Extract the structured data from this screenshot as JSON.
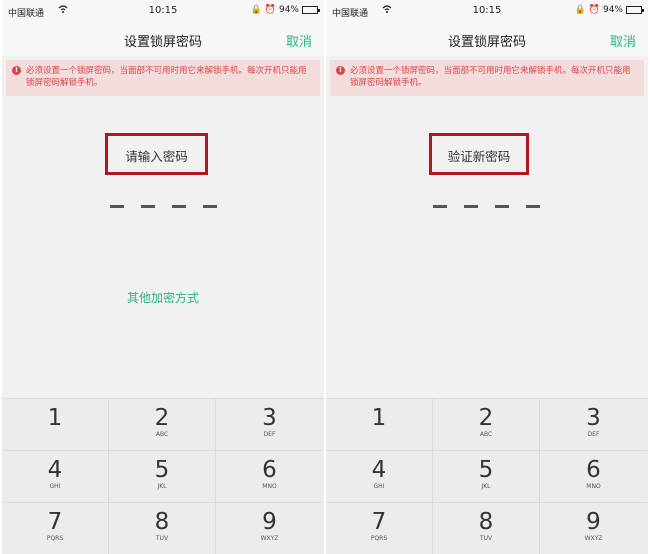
{
  "panels": [
    {
      "status": {
        "carrier": "中国联通",
        "time": "10:15",
        "battery": "94%"
      },
      "header": {
        "title": "设置锁屏密码",
        "cancel": "取消"
      },
      "warning": "必须设置一个锁屏密码，当面部不可用时用它来解锁手机。每次开机只能用锁屏密码解锁手机。",
      "prompt": "请输入密码",
      "alt_link": "其他加密方式",
      "keys": [
        {
          "digit": "1",
          "letters": ""
        },
        {
          "digit": "2",
          "letters": "ABC"
        },
        {
          "digit": "3",
          "letters": "DEF"
        },
        {
          "digit": "4",
          "letters": "GHI"
        },
        {
          "digit": "5",
          "letters": "JKL"
        },
        {
          "digit": "6",
          "letters": "MNO"
        },
        {
          "digit": "7",
          "letters": "PQRS"
        },
        {
          "digit": "8",
          "letters": "TUV"
        },
        {
          "digit": "9",
          "letters": "WXYZ"
        }
      ]
    },
    {
      "status": {
        "carrier": "中国联通",
        "time": "10:15",
        "battery": "94%"
      },
      "header": {
        "title": "设置锁屏密码",
        "cancel": "取消"
      },
      "warning": "必须设置一个锁屏密码，当面部不可用时用它来解锁手机。每次开机只能用锁屏密码解锁手机。",
      "prompt": "验证新密码",
      "keys": [
        {
          "digit": "1",
          "letters": ""
        },
        {
          "digit": "2",
          "letters": "ABC"
        },
        {
          "digit": "3",
          "letters": "DEF"
        },
        {
          "digit": "4",
          "letters": "GHI"
        },
        {
          "digit": "5",
          "letters": "JKL"
        },
        {
          "digit": "6",
          "letters": "MNO"
        },
        {
          "digit": "7",
          "letters": "PQRS"
        },
        {
          "digit": "8",
          "letters": "TUV"
        },
        {
          "digit": "9",
          "letters": "WXYZ"
        }
      ]
    }
  ],
  "icons": {
    "wifi": "wifi-icon",
    "alarm": "alarm-icon",
    "lock": "lock-rotation-icon",
    "battery": "battery-icon",
    "warning": "warning-icon"
  },
  "colors": {
    "accent": "#2bb38a",
    "warning": "#d9474a",
    "highlight_border": "#b0181e"
  },
  "battery_level": 0.94
}
